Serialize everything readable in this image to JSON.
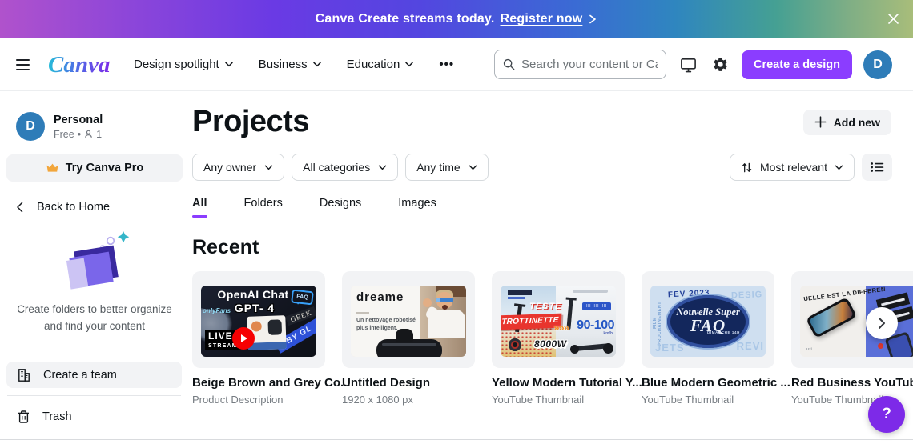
{
  "banner": {
    "message": "Canva Create streams today.",
    "cta": "Register now"
  },
  "header": {
    "logo": "Canva",
    "nav": [
      {
        "label": "Design spotlight"
      },
      {
        "label": "Business"
      },
      {
        "label": "Education"
      },
      {
        "label": "•••"
      }
    ],
    "search_placeholder": "Search your content or Canva's",
    "create_button": "Create a design",
    "avatar_initial": "D"
  },
  "sidebar": {
    "profile": {
      "initial": "D",
      "name": "Personal",
      "plan": "Free",
      "members": "1"
    },
    "try_pro": "Try Canva Pro",
    "back": "Back to Home",
    "note_line1": "Create folders to better organize",
    "note_line2": "and find your content",
    "create_team": "Create a team",
    "trash": "Trash"
  },
  "main": {
    "title": "Projects",
    "add_new": "Add new",
    "filters": {
      "owner": "Any owner",
      "category": "All categories",
      "time": "Any time"
    },
    "sort": "Most relevant",
    "tabs": {
      "all": "All",
      "folders": "Folders",
      "designs": "Designs",
      "images": "Images"
    },
    "section": "Recent",
    "cards": [
      {
        "title": "Beige Brown and Grey Co...",
        "subtitle": "Product Description",
        "thumb": {
          "heading": "OpenAI Chat",
          "subheading": "GPT- 4",
          "watermark": "onlyFans",
          "bubble": "FAQ",
          "tag": "GEEK",
          "ribbon": "BY GL",
          "live1": "LIVE",
          "live2": "STREAM"
        }
      },
      {
        "title": "Untitled Design",
        "subtitle": "1920 x 1080 px",
        "thumb": {
          "brand": "dreame",
          "caption1": "Un nettoyage robotisé",
          "caption2": "plus intelligent."
        }
      },
      {
        "title": "Yellow Modern Tutorial Y...",
        "subtitle": "YouTube Thumbnail",
        "thumb": {
          "teste": "TESTE",
          "banner": "TROTTINETTE",
          "arrows": "»»»",
          "speed": "90-100",
          "unit": "km/h",
          "power": "8000W"
        }
      },
      {
        "title": "Blue Modern Geometric ...",
        "subtitle": "YouTube Thumbnail",
        "thumb": {
          "date": "FEV 2023",
          "word_tr": "DESIG",
          "word_bl": "JETS",
          "word_br": "REVI",
          "side": "FILM PROCHAINEMENT",
          "script": "Nouvelle Super",
          "faq": "FAQ",
          "sub": "DIMANCHE 14H"
        }
      },
      {
        "title": "Red Business YouTube",
        "subtitle": "YouTube Thumbnail",
        "thumb": {
          "headline": "UELLE EST LA DIFFEREN"
        }
      }
    ]
  },
  "help": "?"
}
